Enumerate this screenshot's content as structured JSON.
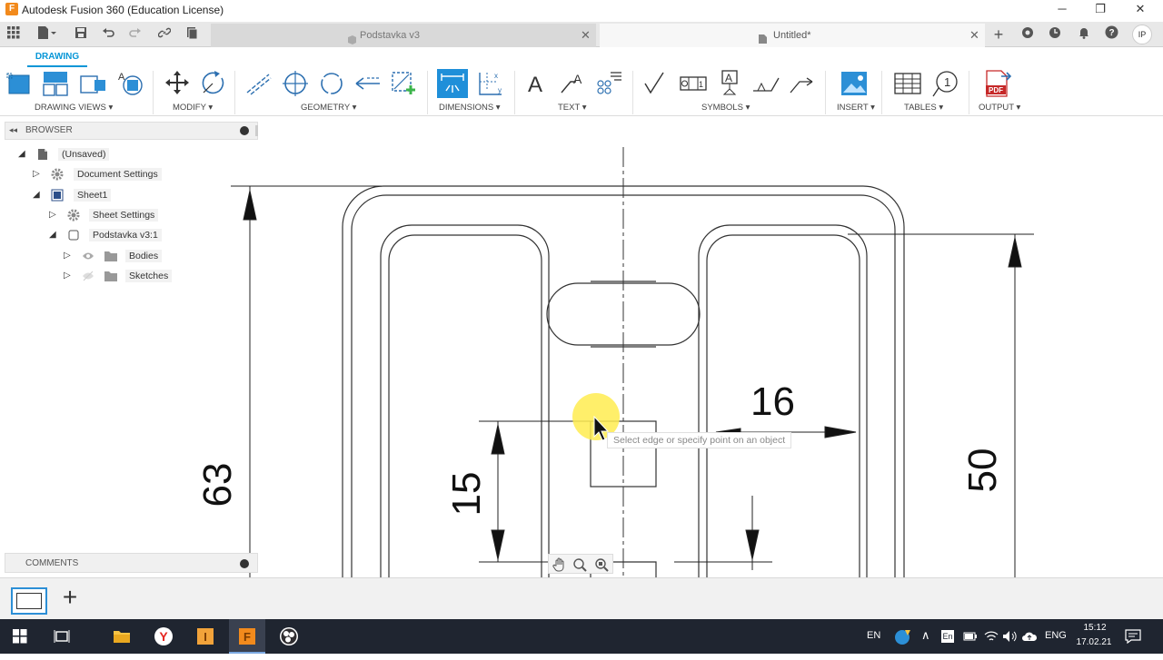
{
  "window": {
    "title": "Autodesk Fusion 360 (Education License)",
    "app_icon_letter": "F",
    "controls": {
      "minimize": "─",
      "restore": "❐",
      "close": "✕"
    }
  },
  "tabs": {
    "items": [
      {
        "label": "Podstavka v3",
        "active": false
      },
      {
        "label": "Untitled*",
        "active": true
      }
    ],
    "close_glyph": "✕",
    "add_glyph": "+",
    "user_initials": "IP"
  },
  "toolbar": {
    "workspace": "DRAWING",
    "groups": [
      {
        "label": "DRAWING VIEWS ▾"
      },
      {
        "label": "MODIFY ▾"
      },
      {
        "label": "GEOMETRY ▾"
      },
      {
        "label": "DIMENSIONS ▾"
      },
      {
        "label": "TEXT ▾"
      },
      {
        "label": "SYMBOLS ▾"
      },
      {
        "label": "INSERT ▾"
      },
      {
        "label": "TABLES ▾"
      },
      {
        "label": "OUTPUT ▾"
      }
    ]
  },
  "browser": {
    "header": "BROWSER",
    "items": [
      {
        "label": "(Unsaved)"
      },
      {
        "label": "Document Settings"
      },
      {
        "label": "Sheet1"
      },
      {
        "label": "Sheet Settings"
      },
      {
        "label": "Podstavka v3:1"
      },
      {
        "label": "Bodies"
      },
      {
        "label": "Sketches"
      }
    ]
  },
  "comments": {
    "header": "COMMENTS"
  },
  "drawing": {
    "dimensions": [
      "63",
      "16",
      "15",
      "50"
    ],
    "tooltip": "Select edge or specify point on an object"
  },
  "sheetbar": {
    "add_glyph": "+"
  },
  "taskbar": {
    "language_short": "EN",
    "language": "ENG",
    "time": "15:12",
    "date": "17.02.21"
  },
  "colors": {
    "accent": "#0696d7",
    "fusion_orange": "#f28a1c",
    "taskbar": "#1f2530"
  }
}
